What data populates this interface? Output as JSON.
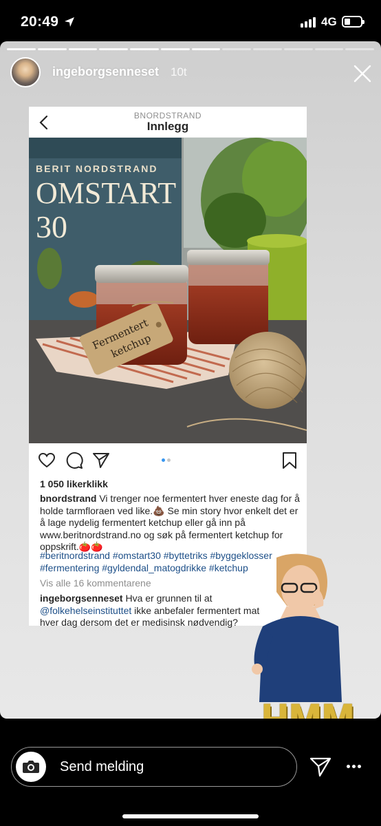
{
  "status_bar": {
    "time": "20:49",
    "network": "4G"
  },
  "story": {
    "username": "ingeborgsenneset",
    "time_ago": "10t",
    "progress_segments_total": 12,
    "progress_segments_seen": 7
  },
  "post": {
    "account_header": "BNORDSTRAND",
    "title": "Innlegg",
    "image_book_author": "BERIT NORDSTRAND",
    "image_book_title": "OMSTART",
    "image_book_number": "30",
    "image_tag_text_1": "Fermentert",
    "image_tag_text_2": "ketchup",
    "carousel_count": 2,
    "carousel_active": 1,
    "likes": "1 050 likerklikk",
    "caption_user": "bnordstrand",
    "caption_text": "Vi trenger noe fermentert hver eneste dag for å holde tarmfloraen ved like.💩 Se min story hvor enkelt det er å lage nydelig fermentert ketchup eller gå inn på www.beritnordstrand.no og søk på fermentert ketchup for oppskrift.🍅🍅",
    "hashtags": "#beritnordstrand #omstart30 #byttetriks #byggeklosser #fermentering #gyldendal_matogdrikke #ketchup",
    "view_comments": "Vis alle 16 kommentarene",
    "comment_user": "ingeborgsenneset",
    "comment_text_1": "Hva er grunnen til at",
    "comment_mention": "@folkehelseinstituttet",
    "comment_text_2": "ikke anbefaler fermentert mat hver dag dersom det er medisinsk nødvendig?"
  },
  "sticker": {
    "text": "HMM..."
  },
  "reply_bar": {
    "placeholder": "Send melding"
  },
  "colors": {
    "link": "#1d4f88",
    "active_dot": "#3897f0",
    "inactive_dot": "#c7c7c7",
    "sticker_gold": "#d9b53a"
  }
}
